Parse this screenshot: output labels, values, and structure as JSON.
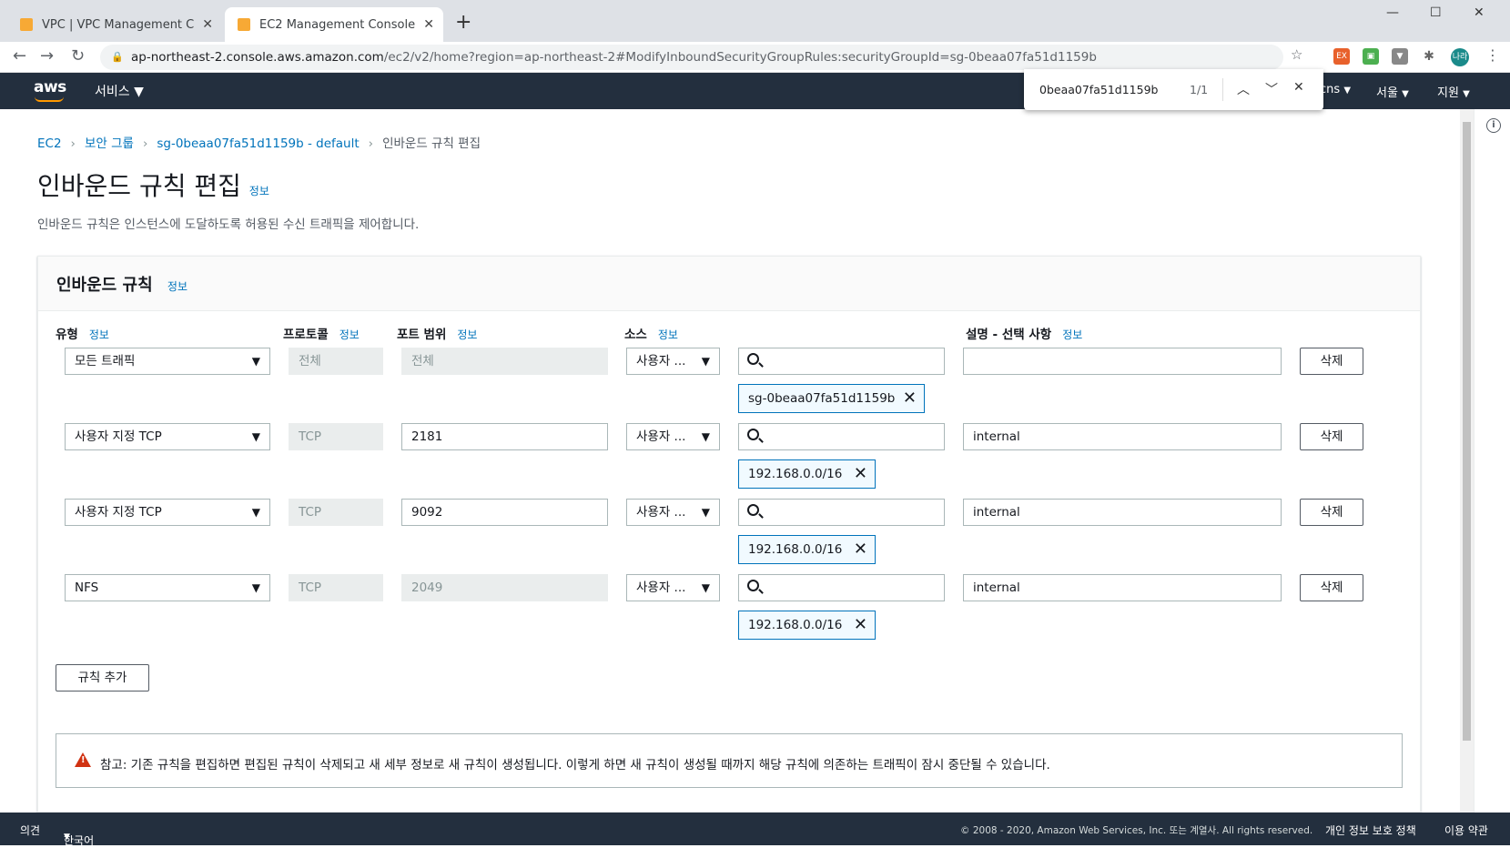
{
  "browser": {
    "tabs": [
      {
        "title": "VPC | VPC Management Console"
      },
      {
        "title": "EC2 Management Console"
      }
    ],
    "url_host": "ap-northeast-2.console.aws.amazon.com",
    "url_path": "/ec2/v2/home?region=ap-northeast-2#ModifyInboundSecurityGroupRules:securityGroupId=sg-0beaa07fa51d1159b",
    "profile": "나라"
  },
  "find": {
    "query": "0beaa07fa51d1159b",
    "count": "1/1"
  },
  "aws_header": {
    "logo": "aws",
    "services": "서비스",
    "account": "cns",
    "region": "서울",
    "support": "지원"
  },
  "breadcrumb": [
    "EC2",
    "보안 그룹",
    "sg-0beaa07fa51d1159b - default",
    "인바운드 규칙 편집"
  ],
  "page": {
    "title": "인바운드 규칙 편집",
    "info": "정보",
    "description": "인바운드 규칙은 인스턴스에 도달하도록 허용된 수신 트래픽을 제어합니다."
  },
  "panel": {
    "title": "인바운드 규칙",
    "info": "정보",
    "columns": {
      "type": "유형",
      "protocol": "프로토콜",
      "port": "포트 범위",
      "source": "소스",
      "description": "설명 - 선택 사항",
      "info": "정보"
    },
    "rules": [
      {
        "type": "모든 트래픽",
        "protocol": "전체",
        "port": "전체",
        "source": "사용자 ...",
        "token": "sg-0beaa07fa51d1159b",
        "description": "",
        "delete": "삭제"
      },
      {
        "type": "사용자 지정 TCP",
        "protocol": "TCP",
        "port": "2181",
        "source": "사용자 ...",
        "token": "192.168.0.0/16",
        "description": "internal",
        "delete": "삭제"
      },
      {
        "type": "사용자 지정 TCP",
        "protocol": "TCP",
        "port": "9092",
        "source": "사용자 ...",
        "token": "192.168.0.0/16",
        "description": "internal",
        "delete": "삭제"
      },
      {
        "type": "NFS",
        "protocol": "TCP",
        "port": "2049",
        "source": "사용자 ...",
        "token": "192.168.0.0/16",
        "description": "internal",
        "delete": "삭제"
      }
    ],
    "add_rule": "규칙 추가",
    "note": "참고: 기존 규칙을 편집하면 편집된 규칙이 삭제되고 새 세부 정보로 새 규칙이 생성됩니다. 이렇게 하면 새 규칙이 생성될 때까지 해당 규칙에 의존하는 트래픽이 잠시 중단될 수 있습니다."
  },
  "footer": {
    "feedback": "의견",
    "language": "한국어",
    "copyright": "© 2008 - 2020, Amazon Web Services, Inc. 또는 계열사. All rights reserved.",
    "privacy": "개인 정보 보호 정책",
    "terms": "이용 약관"
  }
}
